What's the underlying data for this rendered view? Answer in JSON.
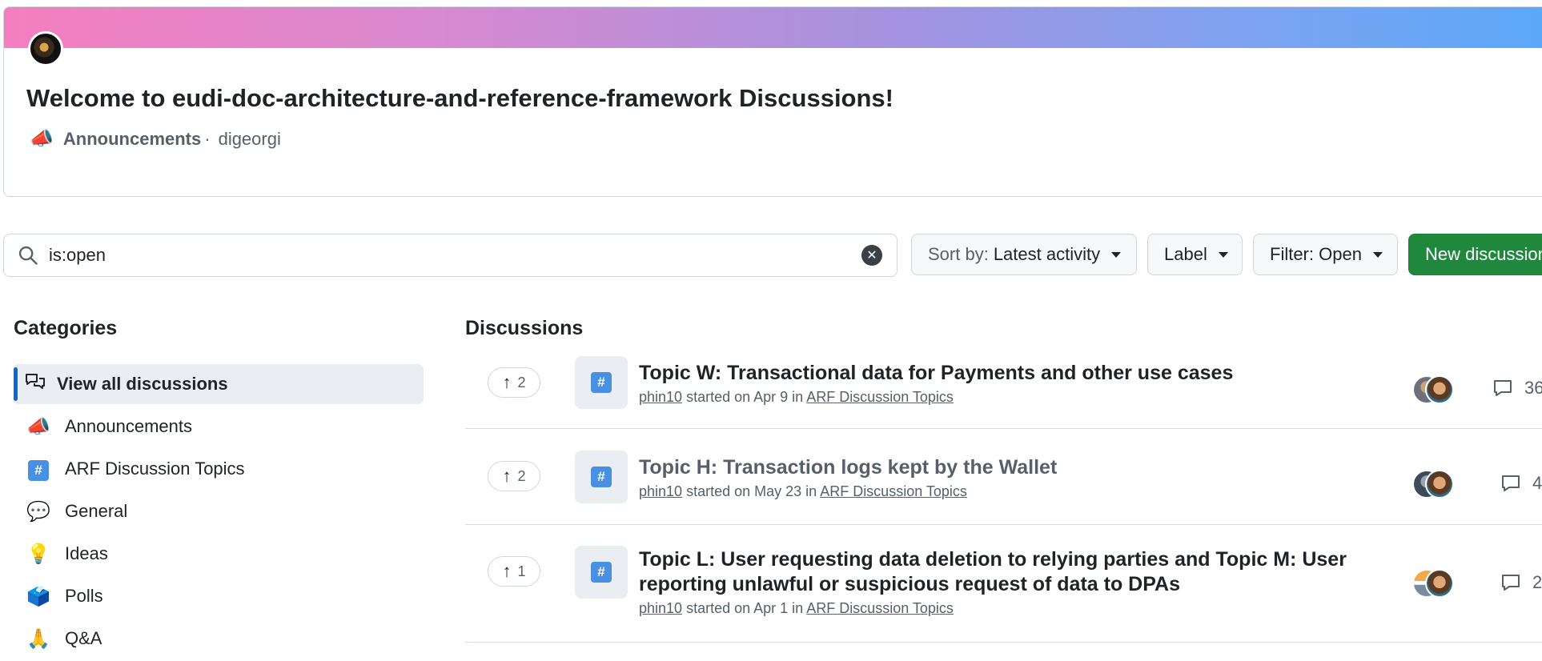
{
  "welcome": {
    "title": "Welcome to eudi-doc-architecture-and-reference-framework Discussions!",
    "category_emoji": "📣",
    "category": "Announcements",
    "separator": "·",
    "author": "digeorgi"
  },
  "toolbar": {
    "search_value": "is:open",
    "sort_prefix": "Sort by:",
    "sort_value": "Latest activity",
    "label_button": "Label",
    "filter_button": "Filter: Open",
    "new_discussion": "New discussion"
  },
  "sidebar": {
    "title": "Categories",
    "items": [
      {
        "label": "View all discussions",
        "icon": "discussions-icon",
        "active": true
      },
      {
        "label": "Announcements",
        "icon": "📣"
      },
      {
        "label": "ARF Discussion Topics",
        "icon": "#"
      },
      {
        "label": "General",
        "icon": "💬"
      },
      {
        "label": "Ideas",
        "icon": "💡"
      },
      {
        "label": "Polls",
        "icon": "🗳️"
      },
      {
        "label": "Q&A",
        "icon": "🙏"
      }
    ]
  },
  "discussions": {
    "title": "Discussions",
    "items": [
      {
        "votes": "2",
        "title": "Topic W: Transactional data for Payments and other use cases",
        "author": "phin10",
        "started": "started on Apr 9 in",
        "category": "ARF Discussion Topics",
        "comments": "36"
      },
      {
        "votes": "2",
        "title": "Topic H: Transaction logs kept by the Wallet",
        "author": "phin10",
        "started": "started on May 23 in",
        "category": "ARF Discussion Topics",
        "comments": "4"
      },
      {
        "votes": "1",
        "title_line1": "Topic L: User requesting data deletion to relying parties and Topic M: User",
        "title_line2": "reporting unlawful or suspicious request of data to DPAs",
        "author": "phin10",
        "started": "started on Apr 1 in",
        "category": "ARF Discussion Topics",
        "comments": "2"
      }
    ]
  },
  "colors": {
    "accent": "#0969da",
    "primary_button": "#1f883d",
    "muted_text": "#57606a"
  }
}
